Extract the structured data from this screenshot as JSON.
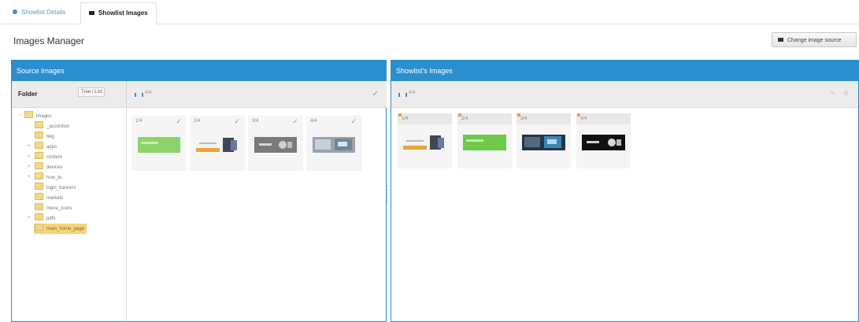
{
  "tabs": [
    {
      "label": "Showlist Details",
      "active": false
    },
    {
      "label": "Showlist Images",
      "active": true
    }
  ],
  "page_title": "Images Manager",
  "change_button": "Change image source",
  "source_panel": {
    "title": "Source Images",
    "folder_label": "Folder",
    "folder_toggle": "Tree / List",
    "count": "4/4",
    "folders": [
      {
        "name": "images",
        "expander": "−"
      },
      {
        "name": "_accordion",
        "expander": ""
      },
      {
        "name": "bkg",
        "expander": ""
      },
      {
        "name": "apps",
        "expander": "+"
      },
      {
        "name": "content",
        "expander": "+"
      },
      {
        "name": "devices",
        "expander": "+"
      },
      {
        "name": "how_to",
        "expander": "+"
      },
      {
        "name": "login_banners",
        "expander": ""
      },
      {
        "name": "markets",
        "expander": ""
      },
      {
        "name": "menu_icons",
        "expander": ""
      },
      {
        "name": "pdfs",
        "expander": "+"
      },
      {
        "name": "main_home_page",
        "expander": "",
        "selected": true
      }
    ],
    "images": [
      {
        "label": "1/4",
        "check": "✓"
      },
      {
        "label": "2/4",
        "check": "✓"
      },
      {
        "label": "3/4",
        "check": "✓"
      },
      {
        "label": "4/4",
        "check": "✓"
      }
    ]
  },
  "showlist_panel": {
    "title": "Showlist's Images",
    "count": "4/4",
    "tools": "✎ ⚙",
    "images": [
      {
        "label": "1/4"
      },
      {
        "label": "2/4"
      },
      {
        "label": "3/4"
      },
      {
        "label": "4/4"
      }
    ]
  },
  "colors": {
    "accent": "#2a8fcf",
    "check": "#6ab55a",
    "selected": "#f6d47c"
  }
}
